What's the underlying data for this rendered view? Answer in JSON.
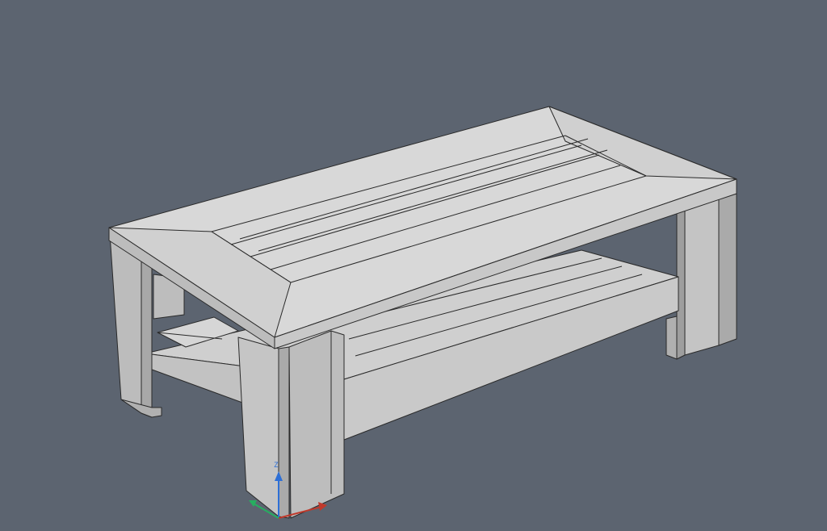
{
  "viewport": {
    "background": "#5c6470",
    "model": "coffee-table",
    "render_style": "shaded-with-edges",
    "face_color_top": "#d6d6d6",
    "face_color_side": "#bdbdbd",
    "edge_color": "#2a2a2a"
  },
  "axes": {
    "z_label": "Z",
    "colors": {
      "x": "#c0392b",
      "y": "#27ae60",
      "z": "#2d6fd6"
    }
  }
}
